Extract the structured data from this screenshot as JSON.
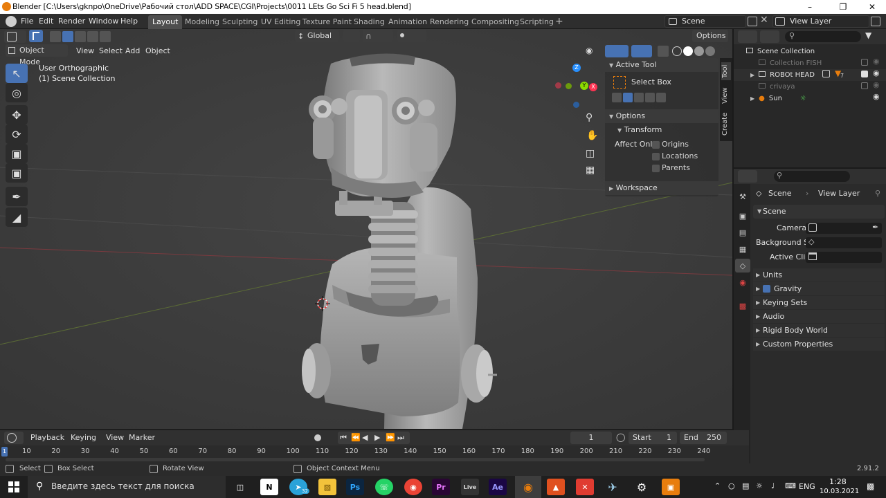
{
  "window": {
    "title": "Blender [C:\\Users\\gknpo\\OneDrive\\Рабочий стол\\ADD SPACE\\CGI\\Projects\\0011 LEts Go Sci Fi 5 head.blend]"
  },
  "menu": [
    "File",
    "Edit",
    "Render",
    "Window",
    "Help"
  ],
  "workspace_tabs": [
    "Layout",
    "Modeling",
    "Sculpting",
    "UV Editing",
    "Texture Paint",
    "Shading",
    "Animation",
    "Rendering",
    "Compositing",
    "Scripting"
  ],
  "active_tab": "Layout",
  "scene_name": "Scene",
  "view_layer_name": "View Layer",
  "viewport_header": {
    "transform_orientation": "Global",
    "options_label": "Options",
    "mode": "Object Mode",
    "view": "View",
    "select": "Select",
    "add": "Add",
    "object": "Object"
  },
  "viewport_info": {
    "view_name": "User Orthographic",
    "collection": "(1) Scene Collection"
  },
  "gizmo": {
    "x": "X",
    "y": "Y",
    "z": "Z"
  },
  "npanel": {
    "active_tool_header": "Active Tool",
    "tool_name": "Select Box",
    "options_header": "Options",
    "transform_header": "Transform",
    "affect_only": "Affect Only",
    "origins": "Origins",
    "locations": "Locations",
    "parents": "Parents",
    "workspace_header": "Workspace",
    "tabs": [
      "Tool",
      "View",
      "Create"
    ]
  },
  "outliner": {
    "root": "Scene Collection",
    "items": [
      {
        "name": "Collection FISH",
        "dim": true
      },
      {
        "name": "ROBOt HEAD",
        "dim": false
      },
      {
        "name": "crivaya",
        "dim": true
      },
      {
        "name": "Sun",
        "dim": false
      }
    ],
    "badge": "7"
  },
  "properties": {
    "breadcrumb_scene": "Scene",
    "breadcrumb_viewlayer": "View Layer",
    "section_scene": "Scene",
    "camera": "Camera",
    "background": "Background S...",
    "active_clip": "Active Clip",
    "panels": [
      "Units",
      "Gravity",
      "Keying Sets",
      "Audio",
      "Rigid Body World",
      "Custom Properties"
    ],
    "gravity_checked": true
  },
  "timeline": {
    "playback": "Playback",
    "keying": "Keying",
    "view": "View",
    "marker": "Marker",
    "current_frame": "1",
    "start_label": "Start",
    "start": "1",
    "end_label": "End",
    "end": "250",
    "ticks": [
      "10",
      "20",
      "30",
      "40",
      "50",
      "60",
      "70",
      "80",
      "90",
      "100",
      "110",
      "120",
      "130",
      "140",
      "150",
      "160",
      "170",
      "180",
      "190",
      "200",
      "210",
      "220",
      "230",
      "240"
    ],
    "playhead": "1"
  },
  "statusbar": {
    "select": "Select",
    "box_select": "Box Select",
    "rotate_view": "Rotate View",
    "context_menu": "Object Context Menu",
    "version": "2.91.2"
  },
  "taskbar": {
    "search_placeholder": "Введите здесь текст для поиска",
    "lang": "ENG",
    "time": "1:28",
    "date": "10.03.2021",
    "badge": "32"
  },
  "colors": {
    "accent": "#4772b3",
    "blender_orange": "#e87d0d",
    "axis_x": "#ff3352",
    "axis_y": "#8bdc00",
    "axis_z": "#2890ff"
  }
}
